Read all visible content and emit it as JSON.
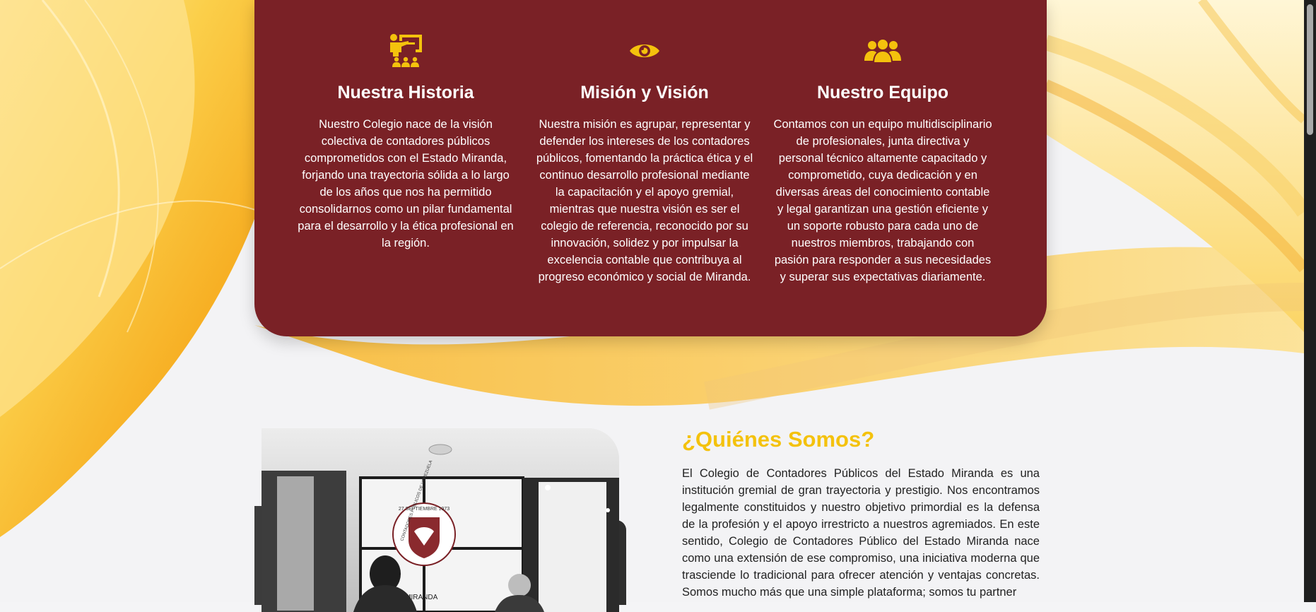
{
  "colors": {
    "card": "#7a2126",
    "accent": "#f4c20d",
    "text_light": "#ffffff",
    "text_dark": "#222222"
  },
  "features": [
    {
      "icon": "presentation-icon",
      "title": "Nuestra Historia",
      "text": "Nuestro Colegio nace de la visión colectiva de contadores públicos comprometidos con el Estado Miranda, forjando una trayectoria sólida a lo largo de los años que nos ha permitido consolidarnos como un pilar fundamental para el desarrollo y la ética profesional en la región."
    },
    {
      "icon": "eye-icon",
      "title": "Misión y Visión",
      "text": "Nuestra misión es agrupar, representar y defender los intereses de los contadores públicos, fomentando la práctica ética y el continuo desarrollo profesional mediante la capacitación y el apoyo gremial, mientras que nuestra visión es ser el colegio de referencia, reconocido por su innovación, solidez y por impulsar la excelencia contable que contribuya al progreso económico y social de Miranda."
    },
    {
      "icon": "team-icon",
      "title": "Nuestro Equipo",
      "text": "Contamos con un equipo multidisciplinario de profesionales, junta directiva y personal técnico altamente capacitado y comprometido, cuya dedicación y en diversas áreas del conocimiento contable y legal garantizan una gestión eficiente y un soporte robusto para cada uno de nuestros miembros, trabajando con pasión para responder a sus necesidades y superar sus expectativas diariamente."
    }
  ],
  "about": {
    "title": "¿Quiénes Somos?",
    "text": "El Colegio de Contadores Públicos del Estado Miranda es una institución gremial de gran trayectoria y prestigio. Nos encontramos legalmente constituidos y nuestro objetivo primordial es la defensa de la profesión y el apoyo irrestricto a nuestros agremiados. En este sentido, Colegio de Contadores Público del Estado Miranda nace como una extensión de ese compromiso, una iniciativa moderna que trasciende lo tradicional para ofrecer atención y ventajas concretas. Somos mucho más que una simple plataforma; somos tu partner",
    "photo": {
      "seal_date": "27 SEPTIEMBRE 1973",
      "seal_ring": "CONTADORES PÚBLICOS DE VENEZUELA",
      "seal_state": "ESTADO MIRANDA"
    }
  }
}
